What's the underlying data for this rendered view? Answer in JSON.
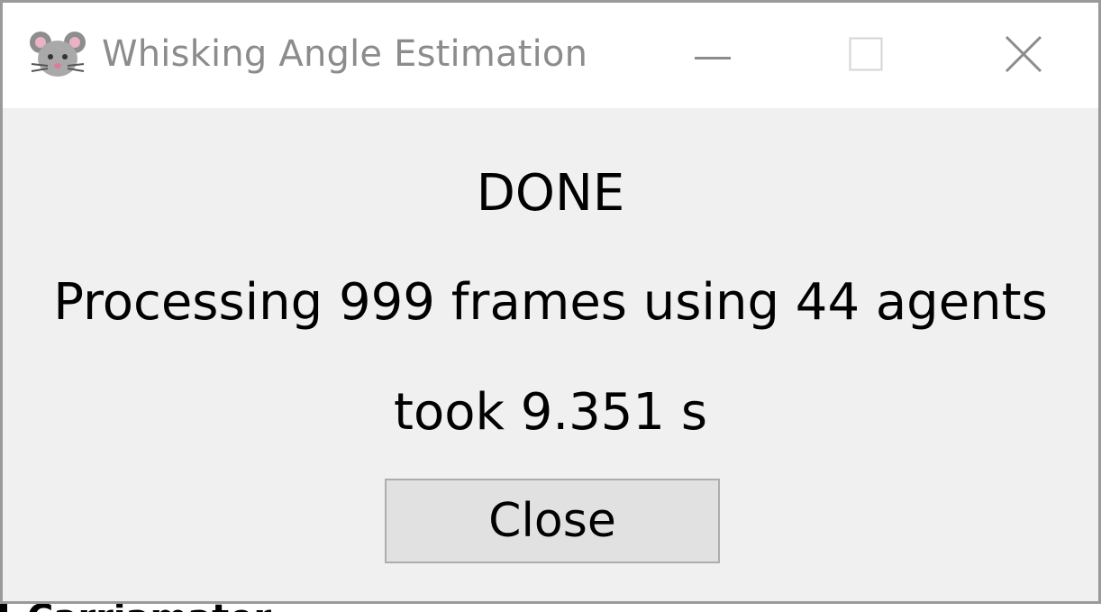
{
  "window": {
    "title": "Whisking Angle Estimation",
    "app_icon": "mouse-icon",
    "controls": {
      "minimize_icon": "minimize-icon",
      "maximize_icon": "maximize-icon",
      "close_icon": "close-icon"
    }
  },
  "dialog": {
    "status": "DONE",
    "message_line": "Processing 999 frames using 44 agents",
    "duration_line": "took 9.351 s",
    "close_label": "Close"
  },
  "background_window": {
    "partial_text": "Carriamater"
  },
  "colors": {
    "titlebar_bg": "#ffffff",
    "content_bg": "#f0f0f0",
    "button_bg": "#e1e1e1",
    "button_border": "#adadad",
    "title_text": "#8c8c8c"
  }
}
